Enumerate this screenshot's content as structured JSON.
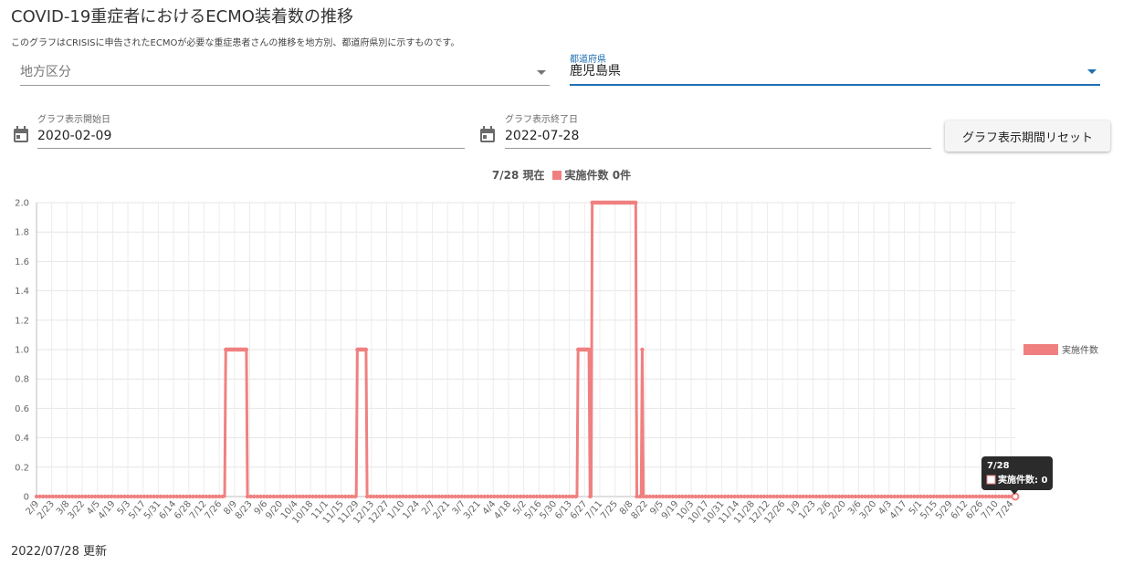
{
  "page": {
    "title": "COVID-19重症者におけるECMO装着数の推移",
    "description": "このグラフはCRISISに申告されたECMOが必要な重症患者さんの推移を地方別、都道府県別に示すものです。"
  },
  "filters": {
    "region": {
      "placeholder": "地方区分",
      "value": ""
    },
    "prefecture": {
      "label": "都道府県",
      "value": "鹿児島県"
    },
    "start_date": {
      "label": "グラフ表示開始日",
      "value": "2020-02-09"
    },
    "end_date": {
      "label": "グラフ表示終了日",
      "value": "2022-07-28"
    },
    "reset_label": "グラフ表示期間リセット"
  },
  "chart_header": {
    "current": "7/28 現在",
    "summary": "実施件数 0件"
  },
  "tooltip": {
    "title": "7/28",
    "body": "実施件数: 0"
  },
  "footer": {
    "updated": "2022/07/28 更新"
  },
  "colors": {
    "series": "#f08080",
    "accent": "#1f6fb2"
  },
  "chart_data": {
    "type": "line",
    "title": "",
    "xlabel": "",
    "ylabel": "",
    "ylim": [
      0,
      2.0
    ],
    "yticks": [
      "0",
      "0.2",
      "0.4",
      "0.6",
      "0.8",
      "1.0",
      "1.2",
      "1.4",
      "1.6",
      "1.8",
      "2.0"
    ],
    "grid": true,
    "legend_position": "right",
    "x_tick_labels": [
      "2/9",
      "2/23",
      "3/8",
      "3/22",
      "4/5",
      "4/19",
      "5/3",
      "5/17",
      "5/31",
      "6/14",
      "6/28",
      "7/12",
      "7/26",
      "8/9",
      "8/23",
      "9/6",
      "9/20",
      "10/4",
      "10/18",
      "11/1",
      "11/15",
      "11/29",
      "12/13",
      "12/27",
      "1/10",
      "1/24",
      "2/7",
      "2/21",
      "3/7",
      "3/21",
      "4/4",
      "4/18",
      "5/2",
      "5/16",
      "5/30",
      "6/13",
      "6/27",
      "7/11",
      "7/25",
      "8/8",
      "8/22",
      "9/5",
      "9/19",
      "10/3",
      "10/17",
      "10/31",
      "11/14",
      "11/28",
      "12/12",
      "12/26",
      "1/9",
      "1/23",
      "2/6",
      "2/20",
      "3/6",
      "3/20",
      "4/3",
      "4/17",
      "5/1",
      "5/15",
      "5/29",
      "6/12",
      "6/26",
      "7/10",
      "7/24"
    ],
    "x_range": [
      "2020-02-09",
      "2022-07-28"
    ],
    "series": [
      {
        "name": "実施件数",
        "segments": [
          {
            "from": "2020-02-09",
            "to": "2020-07-31",
            "value": 0
          },
          {
            "from": "2020-08-01",
            "to": "2020-08-20",
            "value": 1
          },
          {
            "from": "2020-08-21",
            "to": "2020-11-29",
            "value": 0
          },
          {
            "from": "2020-11-30",
            "to": "2020-12-08",
            "value": 1
          },
          {
            "from": "2020-12-09",
            "to": "2021-06-20",
            "value": 0
          },
          {
            "from": "2021-06-21",
            "to": "2021-07-01",
            "value": 1
          },
          {
            "from": "2021-07-02",
            "to": "2021-07-03",
            "value": 0
          },
          {
            "from": "2021-07-04",
            "to": "2021-08-13",
            "value": 2
          },
          {
            "from": "2021-08-14",
            "to": "2021-08-18",
            "value": 0
          },
          {
            "from": "2021-08-19",
            "to": "2021-08-19",
            "value": 1
          },
          {
            "from": "2021-08-20",
            "to": "2022-07-28",
            "value": 0
          }
        ]
      }
    ]
  }
}
